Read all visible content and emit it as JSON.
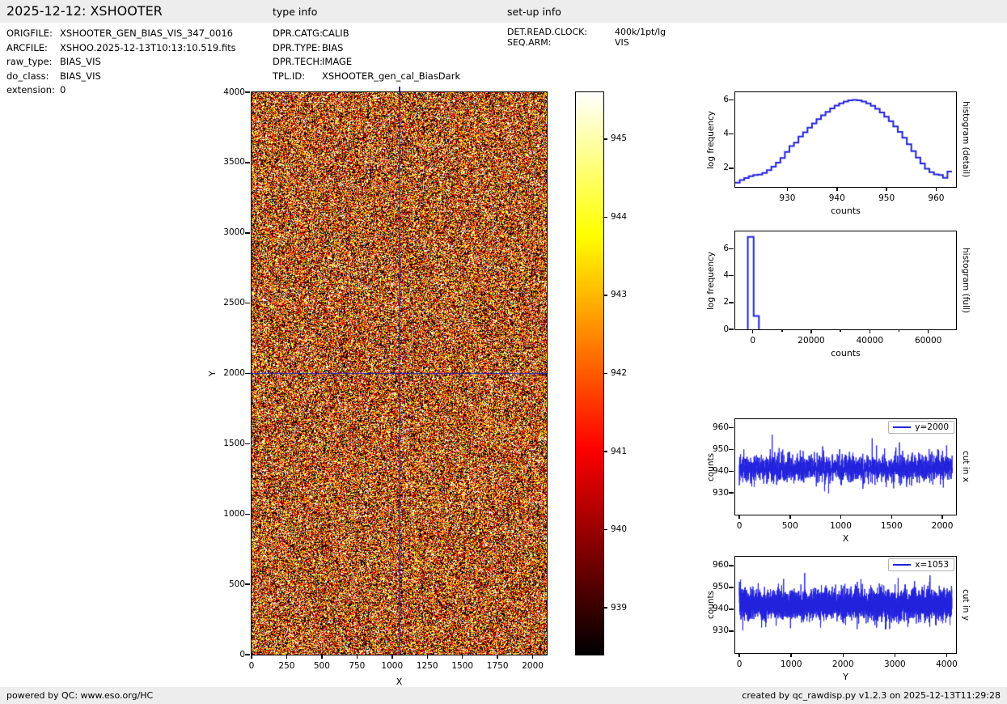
{
  "header": {
    "title": "2025-12-12: XSHOOTER",
    "type_info_label": "type info",
    "setup_info_label": "set-up info"
  },
  "file_info": {
    "rows": [
      {
        "label": "ORIGFILE:",
        "value": "XSHOOTER_GEN_BIAS_VIS_347_0016"
      },
      {
        "label": "ARCFILE:",
        "value": "XSHOO.2025-12-13T10:13:10.519.fits"
      },
      {
        "label": "raw_type:",
        "value": "BIAS_VIS"
      },
      {
        "label": "do_class:",
        "value": "BIAS_VIS"
      },
      {
        "label": "extension:",
        "value": "0"
      }
    ]
  },
  "type_info": {
    "rows": [
      {
        "label": "DPR.CATG:",
        "value": "CALIB"
      },
      {
        "label": "DPR.TYPE:",
        "value": "BIAS"
      },
      {
        "label": "DPR.TECH:",
        "value": "IMAGE"
      },
      {
        "label": "TPL.ID:",
        "value": "XSHOOTER_gen_cal_BiasDark"
      }
    ]
  },
  "setup_info": {
    "rows": [
      {
        "label": "DET.READ.CLOCK:",
        "value": "400k/1pt/lg"
      },
      {
        "label": "SEQ.ARM:",
        "value": "VIS"
      }
    ]
  },
  "footer": {
    "left": "powered by QC: www.eso.org/HC",
    "right": "created by qc_rawdisp.py v1.2.3 on 2025-12-13T11:29:28"
  },
  "colors": {
    "curve_blue": "#2222dd",
    "crosshair_blue": "#2020cc",
    "bar_bg": "#ededed",
    "spine": "#000000",
    "legend_border": "#b3b3b3"
  },
  "chart_data": [
    {
      "id": "main-image",
      "type": "heatmap",
      "xlabel": "X",
      "ylabel": "Y",
      "xlim": [
        0,
        2100
      ],
      "ylim": [
        0,
        4000
      ],
      "x_ticks": [
        0,
        250,
        500,
        750,
        1000,
        1250,
        1500,
        1750,
        2000
      ],
      "y_ticks": [
        0,
        500,
        1000,
        1500,
        2000,
        2500,
        3000,
        3500,
        4000
      ],
      "colormap": "hot",
      "value_range": [
        938.4,
        945.6
      ],
      "mean": 941.4,
      "sigma": 3.5,
      "crosshair": {
        "x": 1053,
        "y": 2000
      },
      "seed": 3
    },
    {
      "id": "colorbar",
      "type": "colorbar",
      "colormap": "hot",
      "range": [
        938.4,
        945.6
      ],
      "ticks": [
        939,
        940,
        941,
        942,
        943,
        944,
        945
      ]
    },
    {
      "id": "hist-detail",
      "type": "histogram",
      "xlabel": "counts",
      "ylabel": "log frequency",
      "right_label": "histogram (detail)",
      "xlim": [
        919.5,
        964
      ],
      "ylim": [
        0.9,
        6.45
      ],
      "x_ticks": [
        930,
        940,
        950,
        960
      ],
      "y_ticks": [
        2,
        4,
        6
      ],
      "bins": {
        "start": 919.5,
        "width": 0.91
      },
      "values": [
        1.15,
        1.3,
        1.42,
        1.53,
        1.6,
        1.62,
        1.72,
        1.88,
        2.08,
        2.32,
        2.6,
        2.95,
        3.3,
        3.5,
        3.85,
        4.1,
        4.38,
        4.62,
        4.87,
        5.1,
        5.3,
        5.5,
        5.67,
        5.8,
        5.9,
        5.97,
        6.0,
        5.98,
        5.9,
        5.8,
        5.66,
        5.48,
        5.27,
        5.02,
        4.75,
        4.45,
        4.12,
        3.78,
        3.4,
        3.0,
        2.62,
        2.27,
        1.97,
        1.77,
        1.63,
        1.6,
        1.43,
        1.8
      ]
    },
    {
      "id": "hist-full",
      "type": "histogram",
      "xlabel": "counts",
      "ylabel": "log frequency",
      "right_label": "histogram (full)",
      "xlim": [
        -6000,
        69500
      ],
      "ylim": [
        0,
        7.3
      ],
      "x_ticks": [
        0,
        20000,
        40000,
        60000
      ],
      "minor_x_ticks": [
        10000,
        30000,
        50000
      ],
      "y_ticks": [
        0,
        2,
        4,
        6
      ],
      "steps": {
        "edges": [
          -1700,
          300,
          2100
        ],
        "values": [
          6.9,
          1.0
        ]
      }
    },
    {
      "id": "cut-x",
      "type": "line",
      "legend": "y=2000",
      "xlabel": "X",
      "ylabel": "counts",
      "right_label": "cut in x",
      "xlim": [
        -40,
        2135
      ],
      "ylim": [
        920,
        964
      ],
      "x_ticks": [
        0,
        500,
        1000,
        1500,
        2000
      ],
      "y_ticks": [
        930,
        940,
        950,
        960
      ],
      "n": 2100,
      "mean": 941.3,
      "sigma": 3.1,
      "seed": 7
    },
    {
      "id": "cut-y",
      "type": "line",
      "legend": "x=1053",
      "xlabel": "Y",
      "ylabel": "counts",
      "right_label": "cut in y",
      "xlim": [
        -80,
        4180
      ],
      "ylim": [
        920,
        964
      ],
      "x_ticks": [
        0,
        1000,
        2000,
        3000,
        4000
      ],
      "y_ticks": [
        930,
        940,
        950,
        960
      ],
      "n": 4100,
      "mean": 942.3,
      "sigma": 3.3,
      "seed": 11
    }
  ]
}
